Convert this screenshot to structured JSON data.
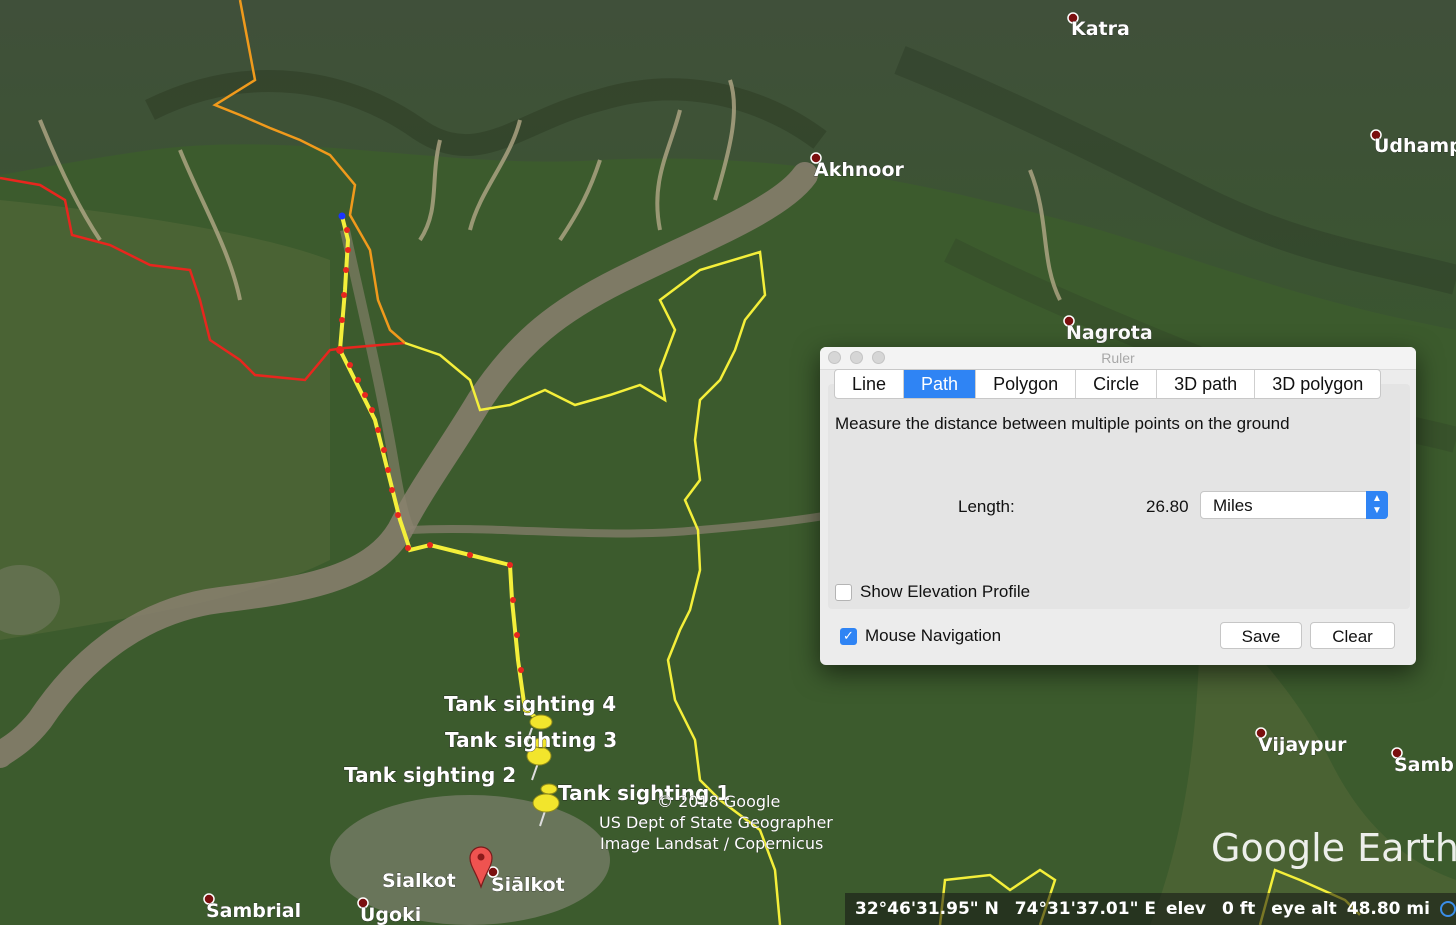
{
  "map": {
    "places": [
      {
        "name": "Katra"
      },
      {
        "name": "Akhnoor"
      },
      {
        "name": "Udhamp"
      },
      {
        "name": "Nagrota"
      },
      {
        "name": "Vijaypur"
      },
      {
        "name": "Samb"
      },
      {
        "name": "Sambrial"
      },
      {
        "name": "Ugoki"
      },
      {
        "name": "Sialkot"
      },
      {
        "name": "Siālkot"
      }
    ],
    "pins": [
      {
        "label": "Tank sighting 4"
      },
      {
        "label": "Tank sighting 3"
      },
      {
        "label": "Tank sighting 2"
      },
      {
        "label": "Tank sighting 1"
      }
    ],
    "attribution": [
      "© 2018 Google",
      "US Dept of State Geographer",
      "Image Landsat / Copernicus"
    ],
    "logo": "Google Earth",
    "colors": {
      "path": "#f4ef3a",
      "border_red": "#e8261e",
      "border_orange": "#f09a1c",
      "boundary_yellow": "#f4ef3a"
    }
  },
  "status": {
    "lat": "32°46'31.95\" N",
    "lon": "74°31'37.01\" E",
    "elev_label": "elev",
    "elev_value": "0 ft",
    "eye_label": "eye alt",
    "eye_value": "48.80 mi"
  },
  "ruler": {
    "title": "Ruler",
    "tabs": [
      "Line",
      "Path",
      "Polygon",
      "Circle",
      "3D path",
      "3D polygon"
    ],
    "active_tab": "Path",
    "description": "Measure the distance between multiple points on the ground",
    "length_label": "Length:",
    "length_value": "26.80",
    "units": "Miles",
    "elevation_profile_label": "Show Elevation Profile",
    "elevation_profile_checked": false,
    "mouse_nav_label": "Mouse Navigation",
    "mouse_nav_checked": true,
    "save_label": "Save",
    "clear_label": "Clear"
  }
}
